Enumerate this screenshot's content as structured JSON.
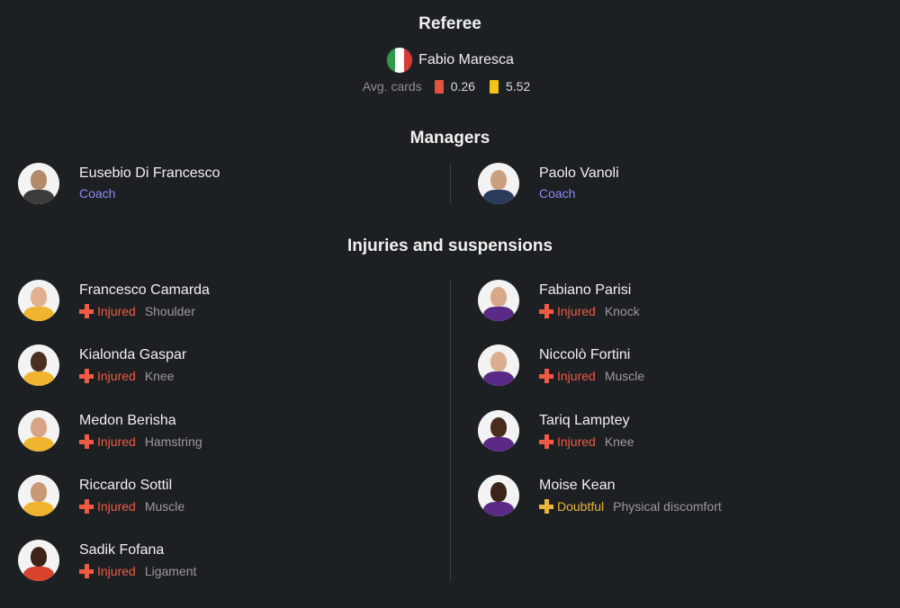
{
  "referee": {
    "title": "Referee",
    "name": "Fabio Maresca",
    "flag_colors": [
      "#2f9a47",
      "#ffffff",
      "#d83a3a"
    ],
    "avg_cards_label": "Avg. cards",
    "red_avg": "0.26",
    "yellow_avg": "5.52",
    "red_color": "#e5533f",
    "yellow_color": "#f0c419"
  },
  "managers": {
    "title": "Managers",
    "home": {
      "name": "Eusebio Di Francesco",
      "role": "Coach"
    },
    "away": {
      "name": "Paolo Vanoli",
      "role": "Coach"
    }
  },
  "injuries": {
    "title": "Injuries and suspensions",
    "home": [
      {
        "name": "Francesco Camarda",
        "status": "Injured",
        "reason": "Shoulder"
      },
      {
        "name": "Kialonda Gaspar",
        "status": "Injured",
        "reason": "Knee"
      },
      {
        "name": "Medon Berisha",
        "status": "Injured",
        "reason": "Hamstring"
      },
      {
        "name": "Riccardo Sottil",
        "status": "Injured",
        "reason": "Muscle"
      },
      {
        "name": "Sadik Fofana",
        "status": "Injured",
        "reason": "Ligament"
      }
    ],
    "away": [
      {
        "name": "Fabiano Parisi",
        "status": "Injured",
        "reason": "Knock"
      },
      {
        "name": "Niccolò Fortini",
        "status": "Injured",
        "reason": "Muscle"
      },
      {
        "name": "Tariq Lamptey",
        "status": "Injured",
        "reason": "Knee"
      },
      {
        "name": "Moise Kean",
        "status": "Doubtful",
        "reason": "Physical discomfort"
      }
    ]
  },
  "colors": {
    "injured": "#ef5a45",
    "doubtful": "#e9b43a",
    "role": "#8c8cf5",
    "home_kit": "#f0b52e",
    "away_kit": "#5a2a86"
  }
}
